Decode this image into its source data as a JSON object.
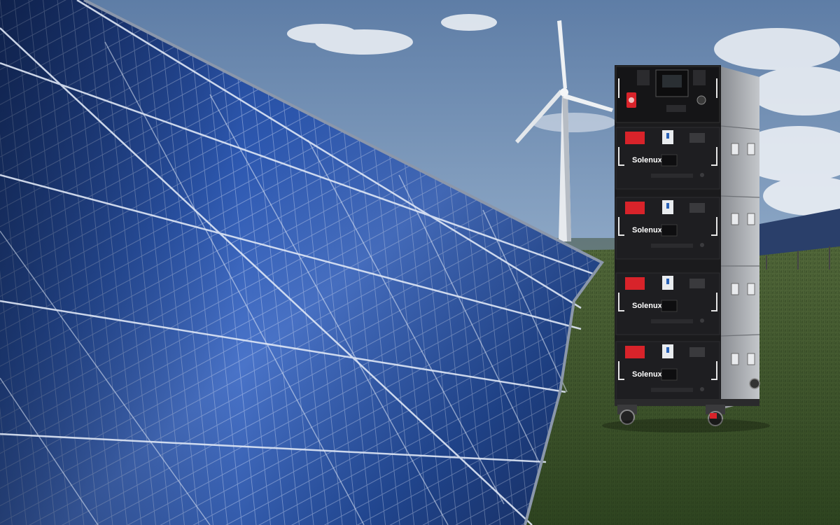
{
  "scene": {
    "description_tags": [
      "solar-panel-array",
      "wind-turbine",
      "battery-storage-rack",
      "grass-field",
      "sky"
    ],
    "colors": {
      "sky_top": "#5f7ea6",
      "sky_bottom": "#c9d6e3",
      "grass": "#3f5a2a",
      "panel_blue": "#1e3f8a",
      "rack_black": "#1b1b1d",
      "accent_red": "#d8232a"
    }
  },
  "battery": {
    "brand": "Solenux",
    "module_count": 4
  }
}
